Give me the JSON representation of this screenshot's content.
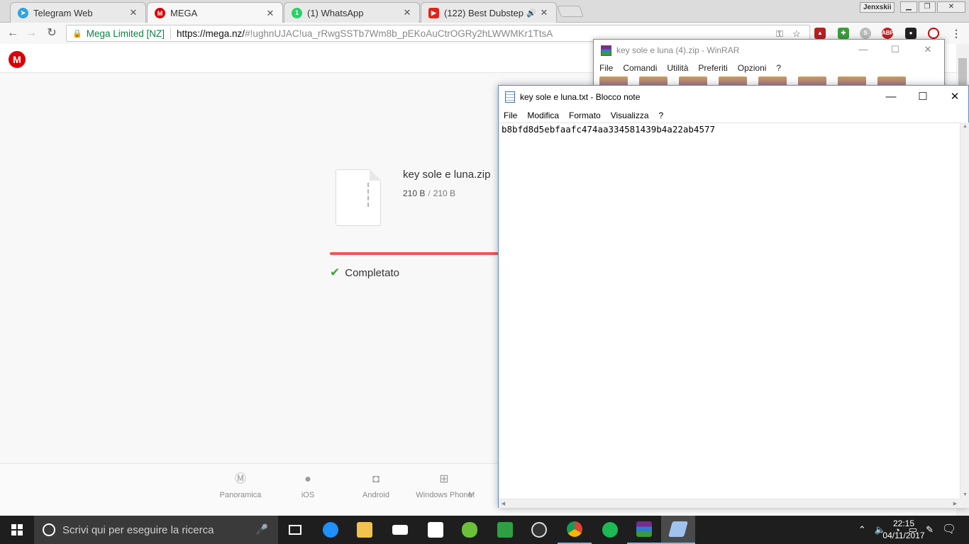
{
  "browser": {
    "tabs": [
      {
        "title": "Telegram Web",
        "icon": "telegram-icon",
        "color": "#2ca5e0"
      },
      {
        "title": "MEGA",
        "icon": "mega-icon",
        "color": "#d90007"
      },
      {
        "title": "(1) WhatsApp",
        "icon": "whatsapp-icon",
        "color": "#25d366"
      },
      {
        "title": "(122) Best Dubstep M",
        "icon": "youtube-icon",
        "color": "#e62117"
      }
    ],
    "profile_name": "Jenxskii",
    "security_label": "Mega Limited [NZ]",
    "url_host": "https://mega.nz/",
    "url_rest": "#!ughnUJAC!ua_rRwgSSTb7Wm8b_pEKoAuCtrOGRy2hLWWMKr1TtsA"
  },
  "mega": {
    "logo": "M",
    "file_name": "key sole e luna.zip",
    "downloaded": "210 B",
    "separator": "/",
    "total": "210 B",
    "progress_fraction": 1.0,
    "status": "Completato",
    "footer_items": [
      {
        "label": "Panoramica",
        "icon": "mega-icon"
      },
      {
        "label": "iOS",
        "icon": "apple-icon"
      },
      {
        "label": "Android",
        "icon": "android-icon"
      },
      {
        "label": "Windows Phone",
        "icon": "windows-icon"
      },
      {
        "label": "M",
        "icon": "more-icon"
      }
    ],
    "accent_color": "#d90007",
    "progress_color": "#e95a5a",
    "check_color": "#3aa83a"
  },
  "winrar": {
    "title": "key sole e luna (4).zip - WinRAR",
    "menu": [
      "File",
      "Comandi",
      "Utilità",
      "Preferiti",
      "Opzioni",
      "?"
    ]
  },
  "notepad": {
    "title": "key sole e luna.txt - Blocco note",
    "menu": [
      "File",
      "Modifica",
      "Formato",
      "Visualizza",
      "?"
    ],
    "content": "b8bfd8d5ebfaafc474aa334581439b4a22ab4577"
  },
  "taskbar": {
    "search_placeholder": "Scrivi qui per eseguire la ricerca",
    "time": "22:15",
    "date": "04/11/2017"
  }
}
